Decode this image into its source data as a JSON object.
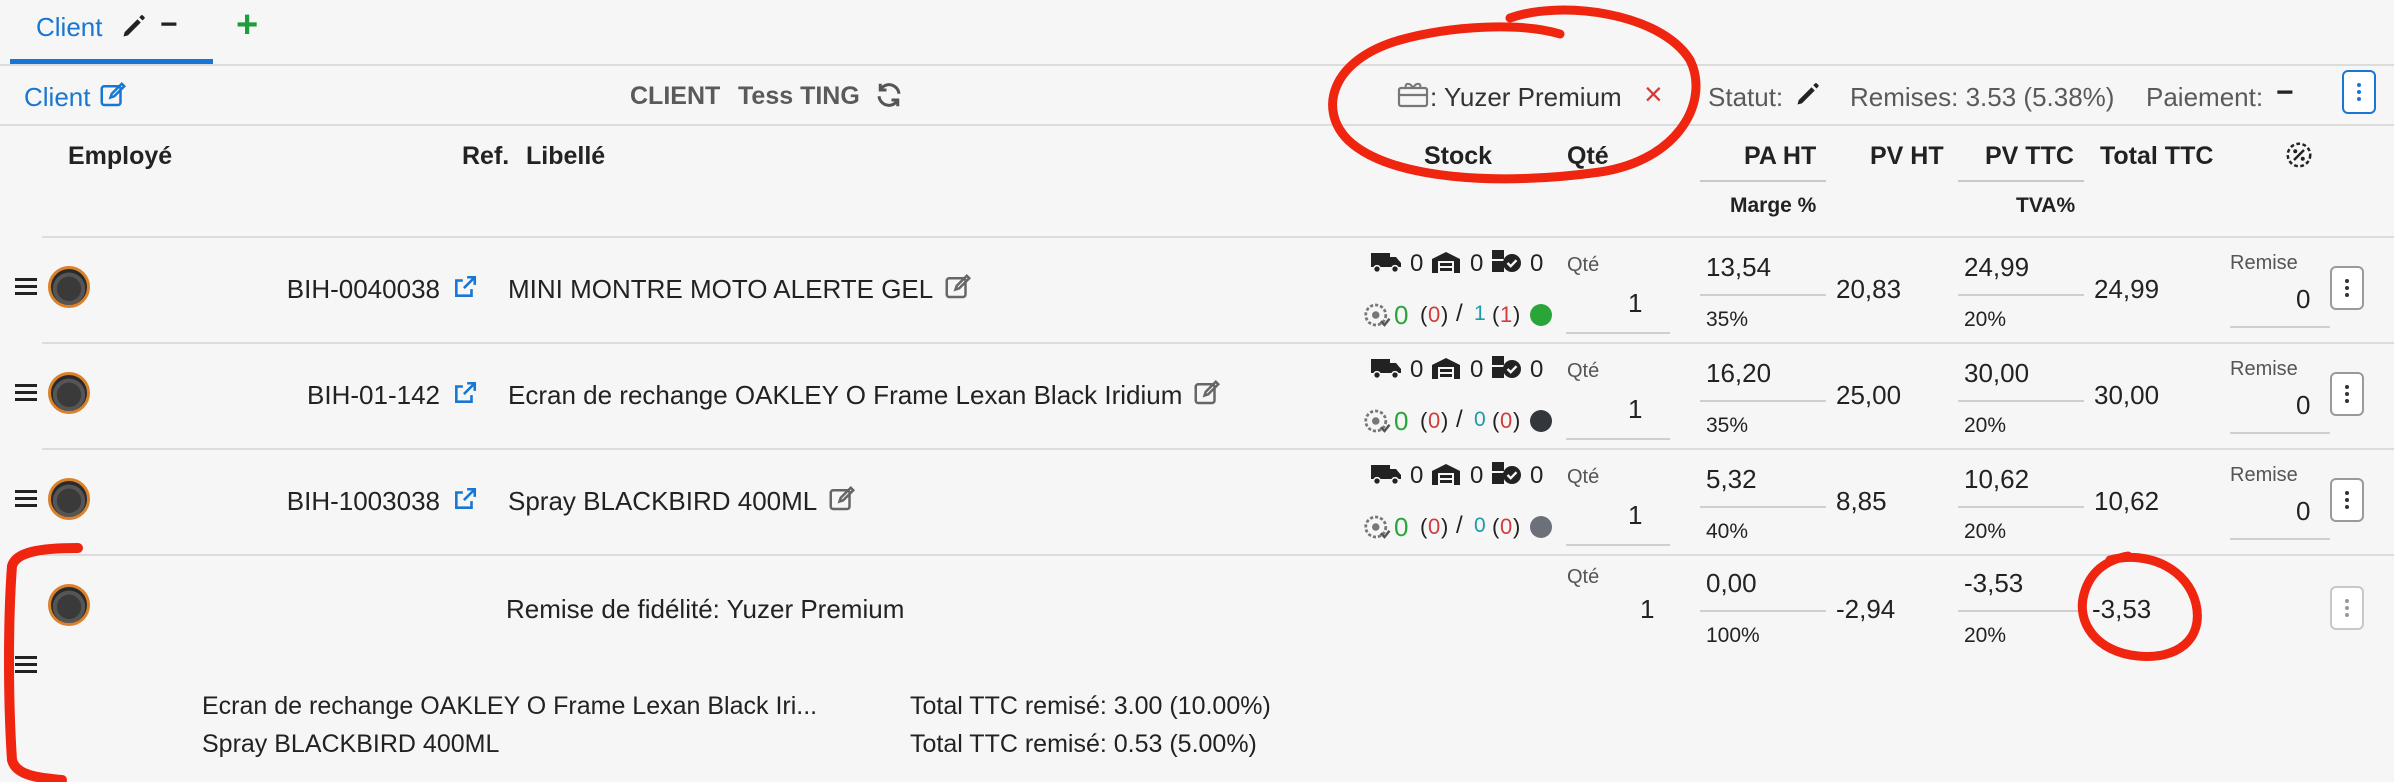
{
  "tabs": {
    "client_tab": "Client",
    "minus": "−",
    "add": "+"
  },
  "bar": {
    "client_link": "Client",
    "client_label": "CLIENT",
    "client_name": "Tess TING",
    "loyalty": ": Yuzer Premium",
    "loyalty_remove": "×",
    "statut": "Statut:",
    "remises": "Remises: 3.53 (5.38%)",
    "paiement": "Paiement:",
    "paiement_value": "−"
  },
  "headers": {
    "employe": "Employé",
    "ref": "Ref.",
    "libelle": "Libellé",
    "stock": "Stock",
    "qte": "Qté",
    "pa_ht": "PA HT",
    "pv_ht": "PV HT",
    "pv_ttc": "PV TTC",
    "total_ttc": "Total TTC",
    "marge": "Marge %",
    "tva": "TVA%"
  },
  "rows": [
    {
      "ref": "BIH-0040038",
      "libelle": "MINI MONTRE MOTO ALERTE GEL",
      "stock_truck": "0",
      "stock_warehouse": "0",
      "stock_check": "0",
      "avail": "0",
      "avail_p1": "0",
      "sep": "/",
      "avail_a": "1",
      "avail_p2": "1",
      "dot_color": "#2aa53a",
      "qte_label": "Qté",
      "qte": "1",
      "pa_ht": "13,54",
      "marge": "35%",
      "pv_ht": "20,83",
      "pv_ttc": "24,99",
      "tva": "20%",
      "total": "24,99",
      "remise_label": "Remise",
      "remise": "0"
    },
    {
      "ref": "BIH-01-142",
      "libelle": "Ecran de rechange OAKLEY O Frame Lexan Black Iridium",
      "stock_truck": "0",
      "stock_warehouse": "0",
      "stock_check": "0",
      "avail": "0",
      "avail_p1": "0",
      "sep": "/",
      "avail_a": "0",
      "avail_p2": "0",
      "dot_color": "#33363d",
      "qte_label": "Qté",
      "qte": "1",
      "pa_ht": "16,20",
      "marge": "35%",
      "pv_ht": "25,00",
      "pv_ttc": "30,00",
      "tva": "20%",
      "total": "30,00",
      "remise_label": "Remise",
      "remise": "0"
    },
    {
      "ref": "BIH-1003038",
      "libelle": "Spray BLACKBIRD 400ML",
      "stock_truck": "0",
      "stock_warehouse": "0",
      "stock_check": "0",
      "avail": "0",
      "avail_p1": "0",
      "sep": "/",
      "avail_a": "0",
      "avail_p2": "0",
      "dot_color": "#6c7078",
      "qte_label": "Qté",
      "qte": "1",
      "pa_ht": "5,32",
      "marge": "40%",
      "pv_ht": "8,85",
      "pv_ttc": "10,62",
      "tva": "20%",
      "total": "10,62",
      "remise_label": "Remise",
      "remise": "0"
    }
  ],
  "loyalty_row": {
    "libelle": "Remise de fidélité: Yuzer Premium",
    "qte_label": "Qté",
    "qte": "1",
    "pa_ht": "0,00",
    "marge": "100%",
    "pv_ht": "-2,94",
    "pv_ttc": "-3,53",
    "tva": "20%",
    "total": "-3,53",
    "details": [
      {
        "item": "Ecran de rechange OAKLEY O Frame Lexan Black Iri...",
        "discount": "Total TTC remisé: 3.00 (10.00%)"
      },
      {
        "item": "Spray BLACKBIRD 400ML",
        "discount": "Total TTC remisé: 0.53 (5.00%)"
      }
    ]
  },
  "colors": {
    "accent": "#1877d2",
    "annotation": "#f02510",
    "add": "#1f9d3a"
  }
}
